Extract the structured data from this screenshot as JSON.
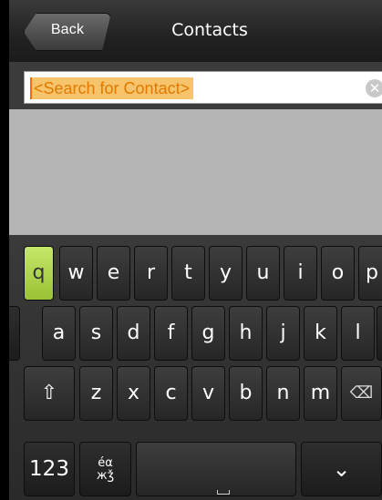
{
  "header": {
    "back_label": "Back",
    "title": "Contacts"
  },
  "search": {
    "value": "<Search for Contact>",
    "clear_icon": "clear-icon"
  },
  "keyboard": {
    "row1": [
      "q",
      "w",
      "e",
      "r",
      "t",
      "y",
      "u",
      "i",
      "o",
      "p"
    ],
    "row2": [
      "a",
      "s",
      "d",
      "f",
      "g",
      "h",
      "j",
      "k",
      "l"
    ],
    "row3": [
      "z",
      "x",
      "c",
      "v",
      "b",
      "n",
      "m"
    ],
    "shift_glyph": "⇧",
    "backspace_glyph": "⌫",
    "numbers_label": "123",
    "lang_label_top": "éα",
    "lang_label_bottom": "жǯ",
    "hide_glyph": "⌄"
  },
  "colors": {
    "header_bg": "#222222",
    "key_bg": "#2e2e2e",
    "key_highlight": "#a8d34a",
    "search_highlight": "#f7c36b",
    "search_text": "#e07a00"
  }
}
